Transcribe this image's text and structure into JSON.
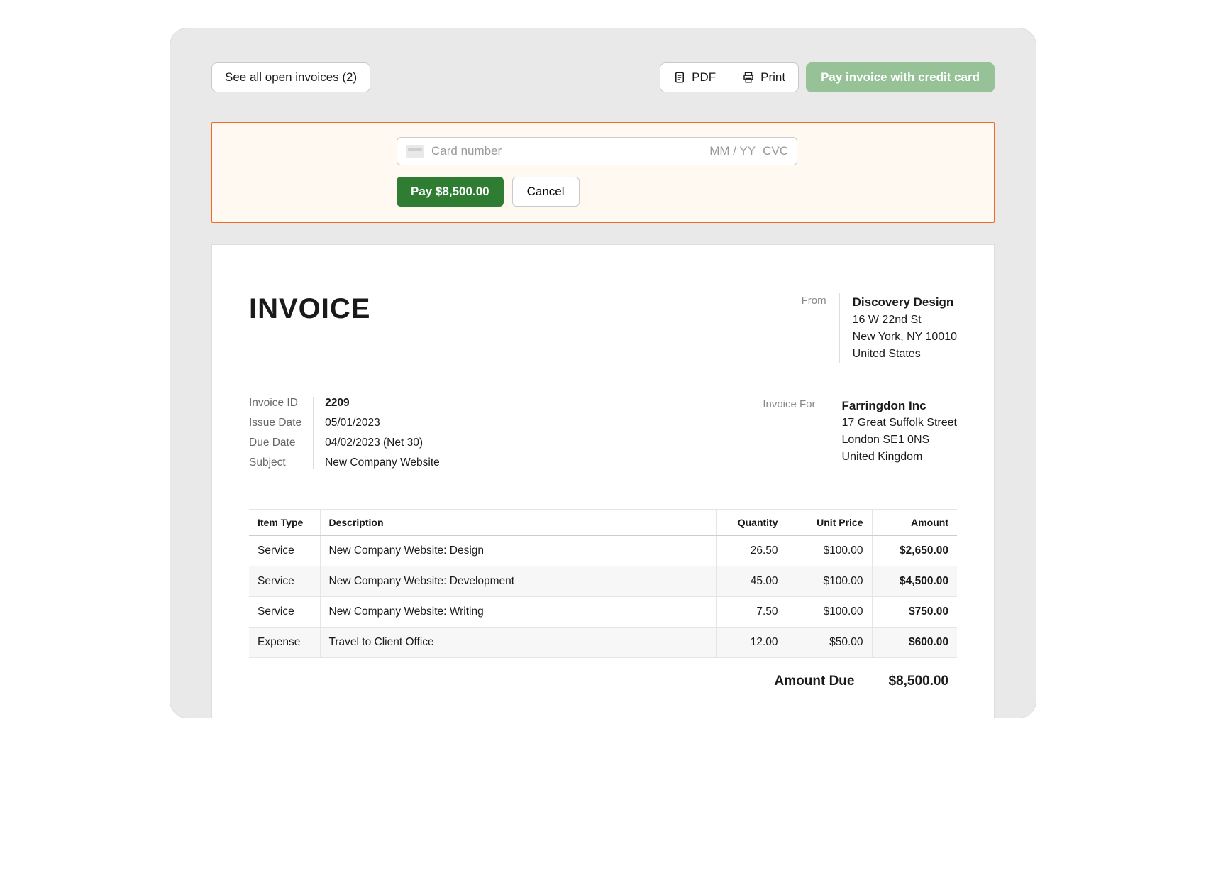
{
  "toolbar": {
    "open_invoices_label": "See all open invoices (2)",
    "pdf_label": "PDF",
    "print_label": "Print",
    "pay_cc_label": "Pay invoice with credit card"
  },
  "payment": {
    "card_placeholder": "Card number",
    "exp_placeholder": "MM / YY",
    "cvc_placeholder": "CVC",
    "pay_button": "Pay $8,500.00",
    "cancel_button": "Cancel"
  },
  "invoice": {
    "title": "INVOICE",
    "from_label": "From",
    "from": {
      "name": "Discovery Design",
      "line1": "16 W 22nd St",
      "line2": "New York, NY 10010",
      "line3": "United States"
    },
    "for_label": "Invoice For",
    "for": {
      "name": "Farringdon Inc",
      "line1": "17 Great Suffolk Street",
      "line2": "London SE1 0NS",
      "line3": "United Kingdom"
    },
    "meta": {
      "id_label": "Invoice ID",
      "id_value": "2209",
      "issue_label": "Issue Date",
      "issue_value": "05/01/2023",
      "due_label": "Due Date",
      "due_value": "04/02/2023 (Net 30)",
      "subject_label": "Subject",
      "subject_value": "New Company Website"
    },
    "columns": {
      "type": "Item Type",
      "description": "Description",
      "quantity": "Quantity",
      "unit_price": "Unit Price",
      "amount": "Amount"
    },
    "items": [
      {
        "type": "Service",
        "description": "New Company Website: Design",
        "quantity": "26.50",
        "unit_price": "$100.00",
        "amount": "$2,650.00"
      },
      {
        "type": "Service",
        "description": "New Company Website: Development",
        "quantity": "45.00",
        "unit_price": "$100.00",
        "amount": "$4,500.00"
      },
      {
        "type": "Service",
        "description": "New Company Website: Writing",
        "quantity": "7.50",
        "unit_price": "$100.00",
        "amount": "$750.00"
      },
      {
        "type": "Expense",
        "description": "Travel to Client Office",
        "quantity": "12.00",
        "unit_price": "$50.00",
        "amount": "$600.00"
      }
    ],
    "totals": {
      "label": "Amount Due",
      "value": "$8,500.00"
    }
  }
}
